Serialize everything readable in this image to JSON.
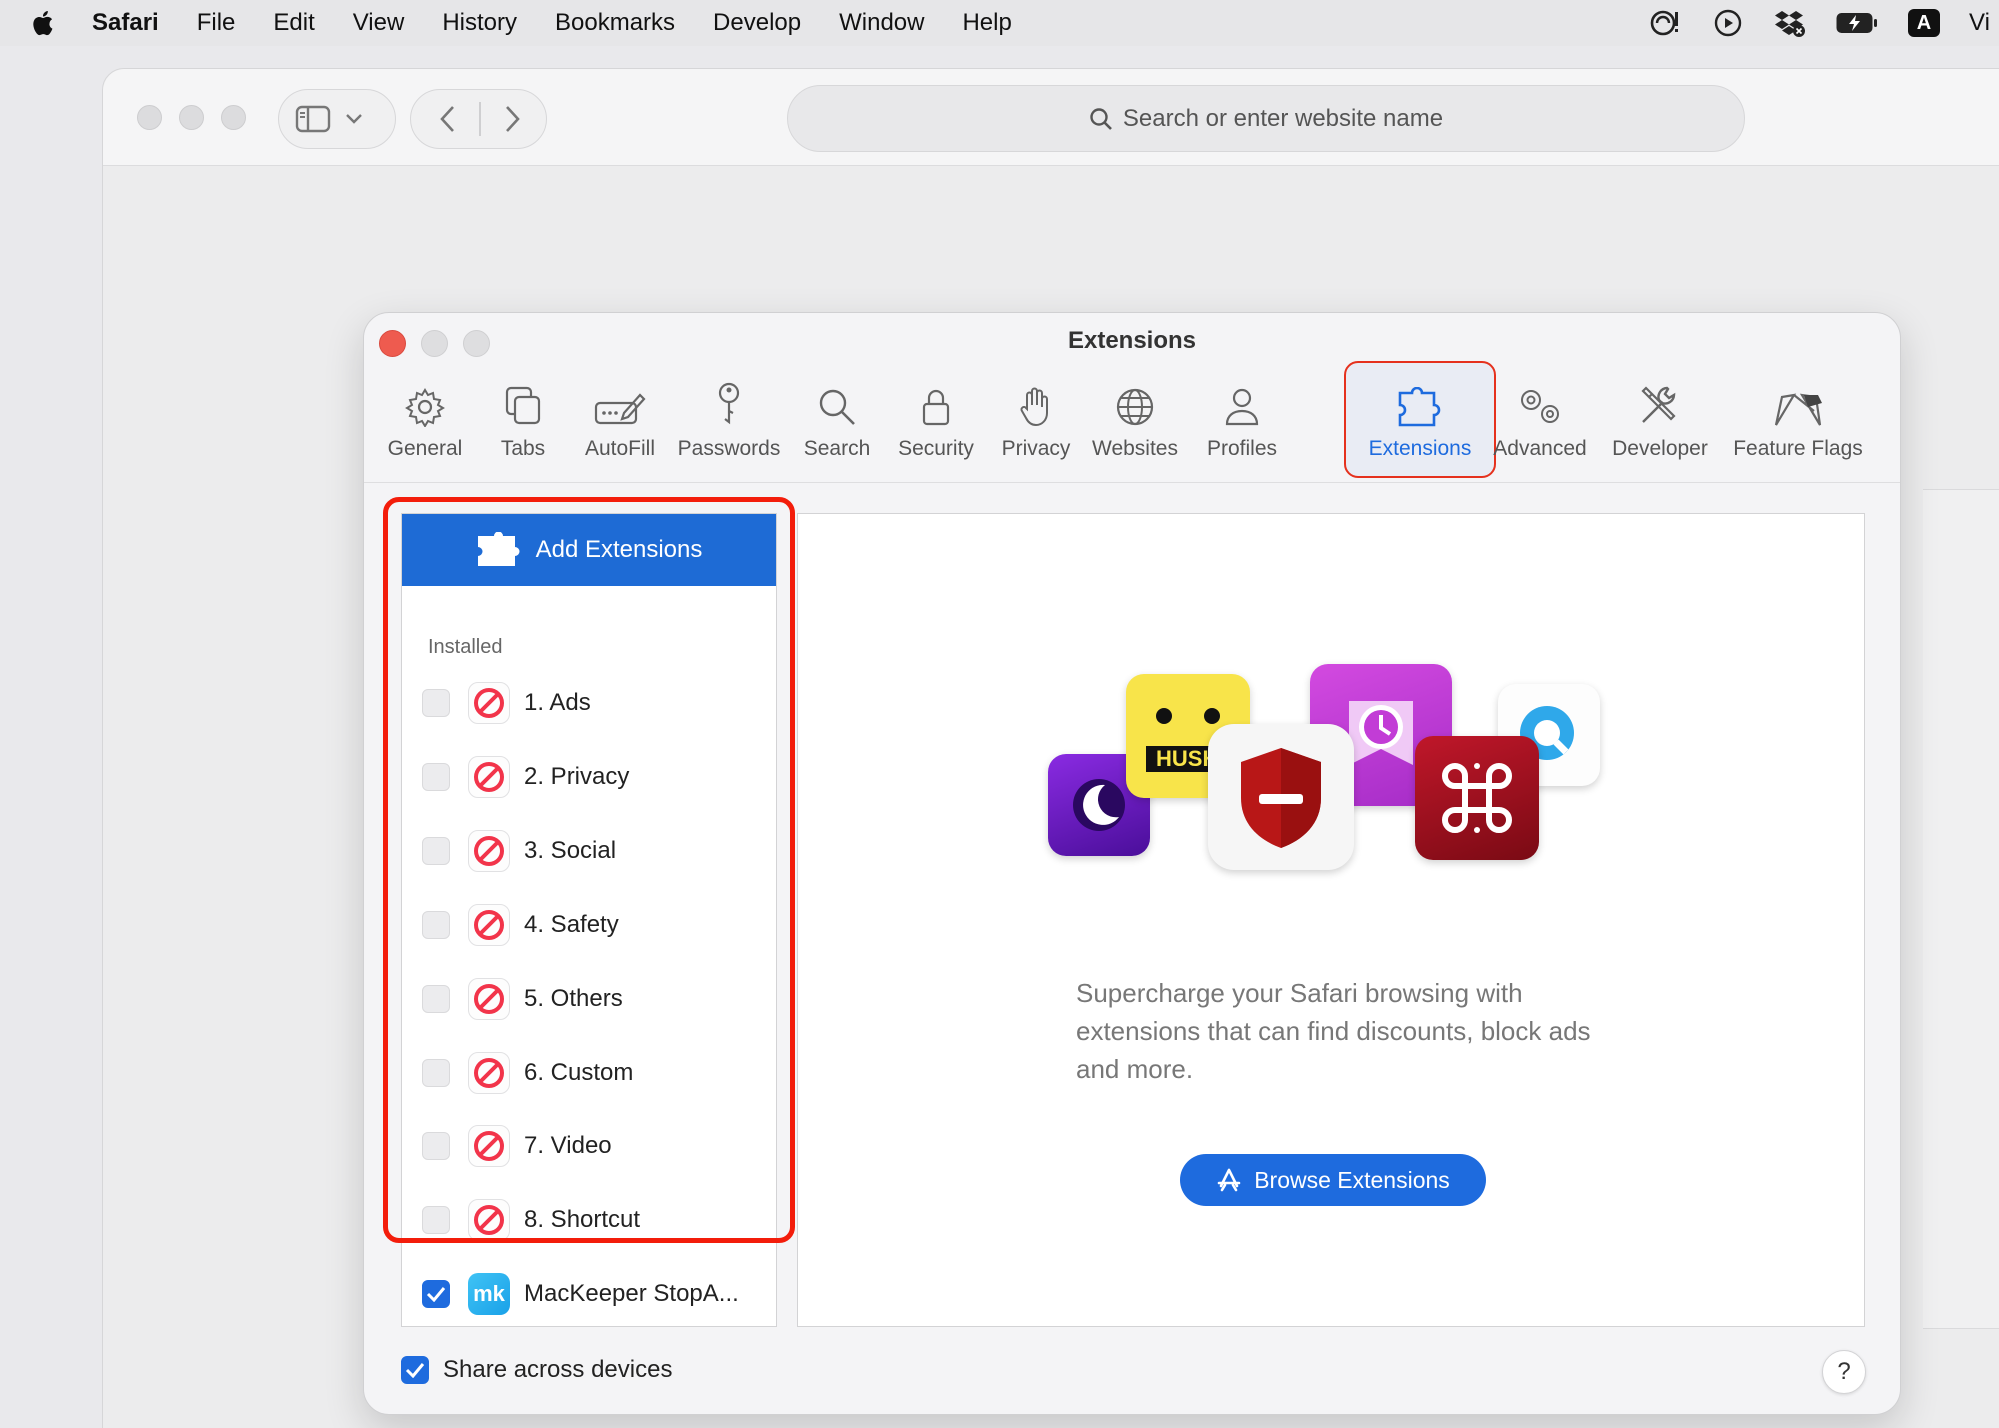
{
  "menubar": {
    "app_name": "Safari",
    "items": [
      "File",
      "Edit",
      "View",
      "History",
      "Bookmarks",
      "Develop",
      "Window",
      "Help"
    ],
    "input_source": "A",
    "user_partial": "Vi"
  },
  "browser": {
    "search_placeholder": "Search or enter website name"
  },
  "prefs": {
    "title": "Extensions",
    "tabs": [
      {
        "label": "General",
        "icon": "gear-icon"
      },
      {
        "label": "Tabs",
        "icon": "tabs-icon"
      },
      {
        "label": "AutoFill",
        "icon": "autofill-icon"
      },
      {
        "label": "Passwords",
        "icon": "key-icon"
      },
      {
        "label": "Search",
        "icon": "search-icon"
      },
      {
        "label": "Security",
        "icon": "lock-icon"
      },
      {
        "label": "Privacy",
        "icon": "hand-icon"
      },
      {
        "label": "Websites",
        "icon": "globe-icon"
      },
      {
        "label": "Profiles",
        "icon": "person-icon"
      },
      {
        "label": "Extensions",
        "icon": "puzzle-icon",
        "active": true
      },
      {
        "label": "Advanced",
        "icon": "gears-icon"
      },
      {
        "label": "Developer",
        "icon": "tools-icon"
      },
      {
        "label": "Feature Flags",
        "icon": "flags-icon"
      }
    ],
    "add_extensions_label": "Add Extensions",
    "installed_label": "Installed",
    "extensions": [
      {
        "label": "1. Ads",
        "checked": false
      },
      {
        "label": "2. Privacy",
        "checked": false
      },
      {
        "label": "3. Social",
        "checked": false
      },
      {
        "label": "4. Safety",
        "checked": false
      },
      {
        "label": "5. Others",
        "checked": false
      },
      {
        "label": "6. Custom",
        "checked": false
      },
      {
        "label": "7. Video",
        "checked": false
      },
      {
        "label": "8. Shortcut",
        "checked": false
      },
      {
        "label": "MacKeeper StopA...",
        "checked": true,
        "icon_text": "mk"
      }
    ],
    "promo_text": "Supercharge your Safari browsing with extensions that can find discounts, block ads and more.",
    "browse_button": "Browse Extensions",
    "share_label": "Share across devices",
    "share_checked": true,
    "help_label": "?",
    "hush_text": "HUSH"
  },
  "colors": {
    "accent": "#1e6bde",
    "highlight": "#f31d0b",
    "close": "#ee5b4f"
  }
}
